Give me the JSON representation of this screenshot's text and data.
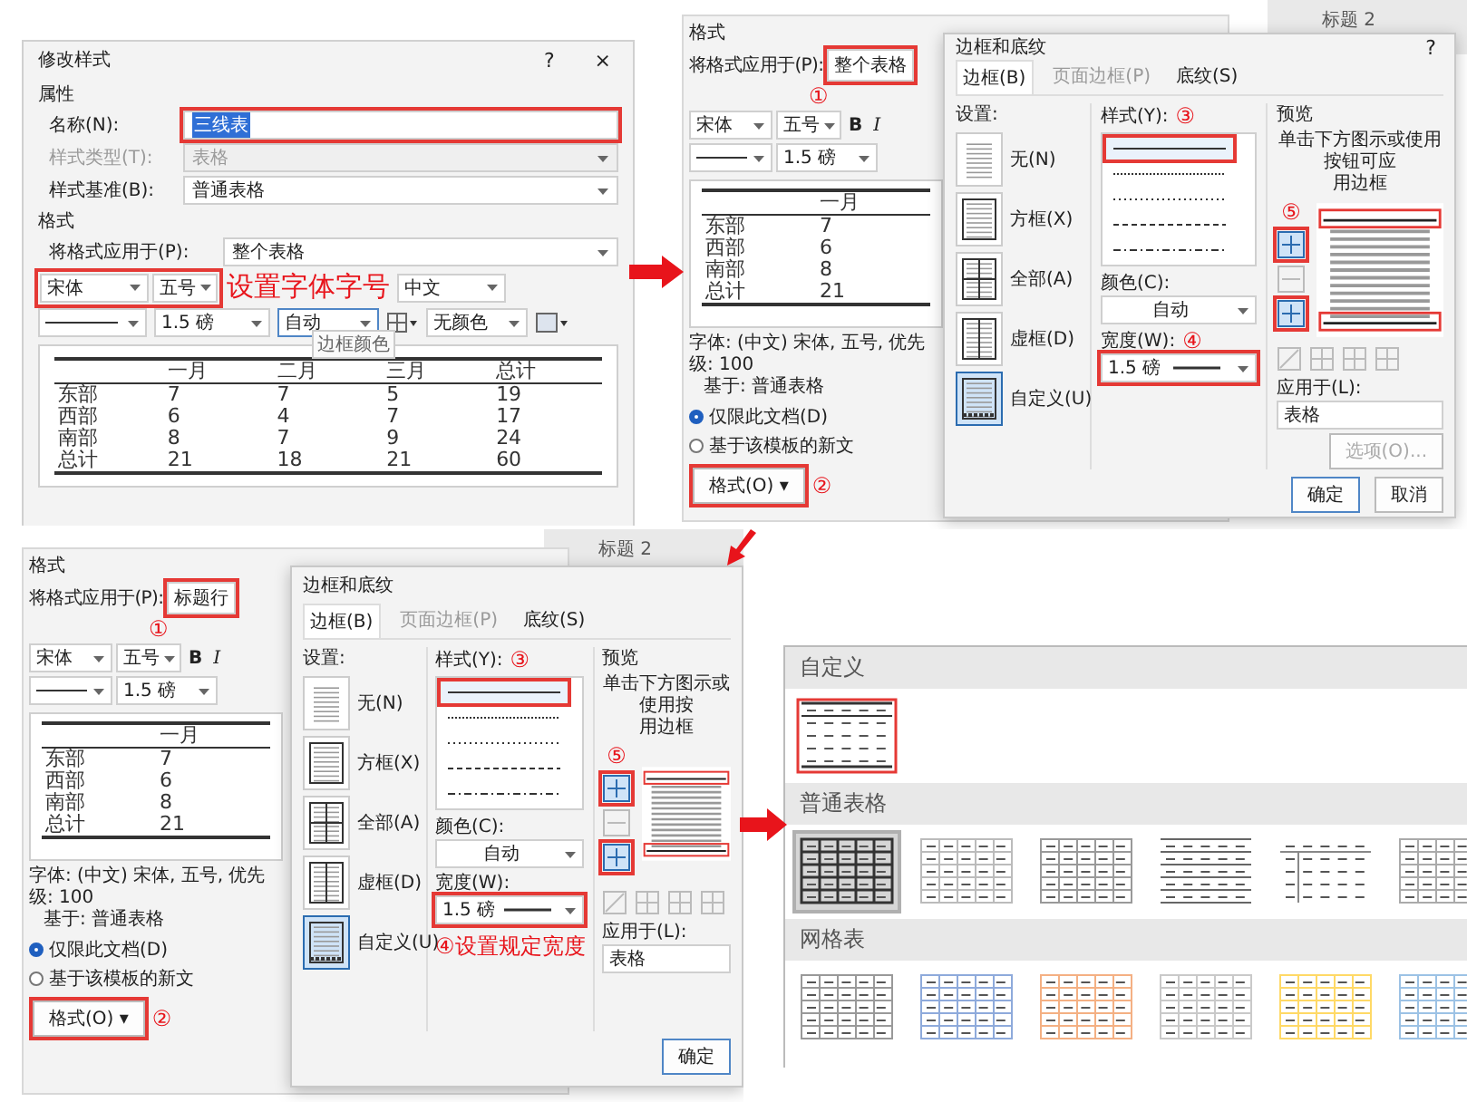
{
  "modify_dialog": {
    "title": "修改样式",
    "help": "?",
    "close": "×",
    "properties_heading": "属性",
    "fields": [
      {
        "label": "名称(N):",
        "value": "三线表",
        "disabled": false,
        "dropdown": false,
        "highlighted": true,
        "text_selected": true
      },
      {
        "label": "样式类型(T):",
        "value": "表格",
        "disabled": true,
        "dropdown": true,
        "highlighted": false,
        "text_selected": false
      },
      {
        "label": "样式基准(B):",
        "value": "普通表格",
        "disabled": false,
        "dropdown": true,
        "highlighted": false,
        "text_selected": false
      }
    ],
    "format_heading": "格式",
    "apply_label": "将格式应用于(P):",
    "apply_value": "整个表格",
    "font": "宋体",
    "size": "五号",
    "annotation": "设置字体字号",
    "language": "中文",
    "line_width": "1.5 磅",
    "border_color": "自动",
    "shading": "无颜色",
    "tooltip": "边框颜色",
    "table": {
      "columns": [
        "",
        "一月",
        "二月",
        "三月",
        "总计"
      ],
      "rows": [
        [
          "东部",
          "7",
          "7",
          "5",
          "19"
        ],
        [
          "西部",
          "6",
          "4",
          "7",
          "17"
        ],
        [
          "南部",
          "8",
          "7",
          "9",
          "24"
        ],
        [
          "总计",
          "21",
          "18",
          "21",
          "60"
        ]
      ]
    }
  },
  "steps": [
    {
      "back": {
        "format_heading": "格式",
        "apply_label": "将格式应用于(P):",
        "apply_value": "整个表格",
        "apply_mark": "①",
        "font": "宋体",
        "size": "五号",
        "bold": "B",
        "italic": "I",
        "line_width": "1.5 磅",
        "table": {
          "columns": [
            "",
            "一月"
          ],
          "rows": [
            [
              "东部",
              "7"
            ],
            [
              "西部",
              "6"
            ],
            [
              "南部",
              "8"
            ],
            [
              "总计",
              "21"
            ]
          ]
        },
        "description": [
          "字体: (中文) 宋体, 五号, 优先级: 100",
          "基于: 普通表格"
        ],
        "radios": [
          {
            "label": "仅限此文档(D)",
            "selected": true
          },
          {
            "label": "基于该模板的新文",
            "selected": false
          }
        ],
        "format_button": "格式(O) ▾",
        "format_mark": "②",
        "behind_text": "标题 2"
      },
      "front": {
        "title": "边框和底纹",
        "help": "?",
        "tabs": [
          {
            "label": "边框(B)",
            "selected": true,
            "disabled": false
          },
          {
            "label": "页面边框(P)",
            "selected": false,
            "disabled": true
          },
          {
            "label": "底纹(S)",
            "selected": false,
            "disabled": false
          }
        ],
        "settings_label": "设置:",
        "settings": [
          {
            "label": "无(N)",
            "kind": "none",
            "selected": false
          },
          {
            "label": "方框(X)",
            "kind": "box",
            "selected": false
          },
          {
            "label": "全部(A)",
            "kind": "all",
            "selected": false
          },
          {
            "label": "虚框(D)",
            "kind": "grid",
            "selected": false
          },
          {
            "label": "自定义(U)",
            "kind": "custom",
            "selected": true
          }
        ],
        "style_label": "样式(Y):",
        "style_mark": "③",
        "styles": [
          {
            "kind": "solid",
            "selected": true
          },
          {
            "kind": "fine-dotted",
            "selected": false
          },
          {
            "kind": "dotted",
            "selected": false
          },
          {
            "kind": "dashed",
            "selected": false
          },
          {
            "kind": "dash-dot",
            "selected": false
          }
        ],
        "color_label": "颜色(C):",
        "color_value": "自动",
        "width_label": "宽度(W):",
        "width_mark": "④",
        "width_value": "1.5 磅",
        "preview_label": "预览",
        "preview_hint": [
          "单击下方图示或使用按钮可应",
          "用边框"
        ],
        "preview_mark": "⑤",
        "apply_label": "应用于(L):",
        "apply_value": "表格",
        "options_button": "选项(O)...",
        "ok": "确定",
        "cancel": "取消"
      }
    },
    {
      "back": {
        "format_heading": "格式",
        "apply_label": "将格式应用于(P):",
        "apply_value": "标题行",
        "apply_mark": "①",
        "font": "宋体",
        "size": "五号",
        "bold": "B",
        "italic": "I",
        "line_width": "1.5 磅",
        "table": {
          "columns": [
            "",
            "一月"
          ],
          "rows": [
            [
              "东部",
              "7"
            ],
            [
              "西部",
              "6"
            ],
            [
              "南部",
              "8"
            ],
            [
              "总计",
              "21"
            ]
          ]
        },
        "description": [
          "字体: (中文) 宋体, 五号, 优先级: 100",
          "基于: 普通表格"
        ],
        "radios": [
          {
            "label": "仅限此文档(D)",
            "selected": true
          },
          {
            "label": "基于该模板的新文",
            "selected": false
          }
        ],
        "format_button": "格式(O) ▾",
        "format_mark": "②",
        "behind_text": "标题 2"
      },
      "front": {
        "title": "边框和底纹",
        "tabs": [
          {
            "label": "边框(B)",
            "selected": true,
            "disabled": false
          },
          {
            "label": "页面边框(P)",
            "selected": false,
            "disabled": true
          },
          {
            "label": "底纹(S)",
            "selected": false,
            "disabled": false
          }
        ],
        "settings_label": "设置:",
        "settings": [
          {
            "label": "无(N)",
            "kind": "none",
            "selected": false
          },
          {
            "label": "方框(X)",
            "kind": "box",
            "selected": false
          },
          {
            "label": "全部(A)",
            "kind": "all",
            "selected": false
          },
          {
            "label": "虚框(D)",
            "kind": "grid",
            "selected": false
          },
          {
            "label": "自定义(U)",
            "kind": "custom",
            "selected": true
          }
        ],
        "style_label": "样式(Y):",
        "style_mark": "③",
        "styles": [
          {
            "kind": "solid",
            "selected": true
          },
          {
            "kind": "fine-dotted",
            "selected": false
          },
          {
            "kind": "dotted",
            "selected": false
          },
          {
            "kind": "dashed",
            "selected": false
          },
          {
            "kind": "dash-dot",
            "selected": false
          }
        ],
        "color_label": "颜色(C):",
        "color_value": "自动",
        "width_label": "宽度(W):",
        "width_value": "1.5 磅",
        "width_annotation": "④设置规定宽度",
        "preview_label": "预览",
        "preview_hint": [
          "单击下方图示或使用按",
          "用边框"
        ],
        "preview_mark": "⑤",
        "apply_label": "应用于(L):",
        "apply_value": "表格",
        "ok": "确定"
      }
    }
  ],
  "gallery": {
    "sections": [
      {
        "title": "自定义",
        "thumbs": [
          {
            "kind": "three-line",
            "color": "#333333",
            "selected": false,
            "highlighted": true
          }
        ]
      },
      {
        "title": "普通表格",
        "thumbs": [
          {
            "kind": "grid",
            "color": "#333333",
            "selected": true,
            "highlighted": false
          },
          {
            "kind": "grid",
            "color": "#bbbbbb",
            "selected": false,
            "highlighted": false
          },
          {
            "kind": "grid",
            "color": "#999999",
            "selected": false,
            "highlighted": false
          },
          {
            "kind": "lines",
            "color": "#666666",
            "selected": false,
            "highlighted": false
          },
          {
            "kind": "header-lines",
            "color": "#888888",
            "selected": false,
            "highlighted": false
          },
          {
            "kind": "grid",
            "color": "#aaaaaa",
            "selected": false,
            "highlighted": false
          }
        ]
      },
      {
        "title": "网格表",
        "thumbs": [
          {
            "kind": "grid",
            "color": "#999999",
            "selected": false,
            "highlighted": false
          },
          {
            "kind": "grid",
            "color": "#8eaadb",
            "selected": false,
            "highlighted": false
          },
          {
            "kind": "grid",
            "color": "#f4b083",
            "selected": false,
            "highlighted": false
          },
          {
            "kind": "grid",
            "color": "#c9c9c9",
            "selected": false,
            "highlighted": false
          },
          {
            "kind": "grid",
            "color": "#ffd966",
            "selected": false,
            "highlighted": false
          },
          {
            "kind": "grid",
            "color": "#9cc2e5",
            "selected": false,
            "highlighted": false
          }
        ]
      }
    ]
  }
}
